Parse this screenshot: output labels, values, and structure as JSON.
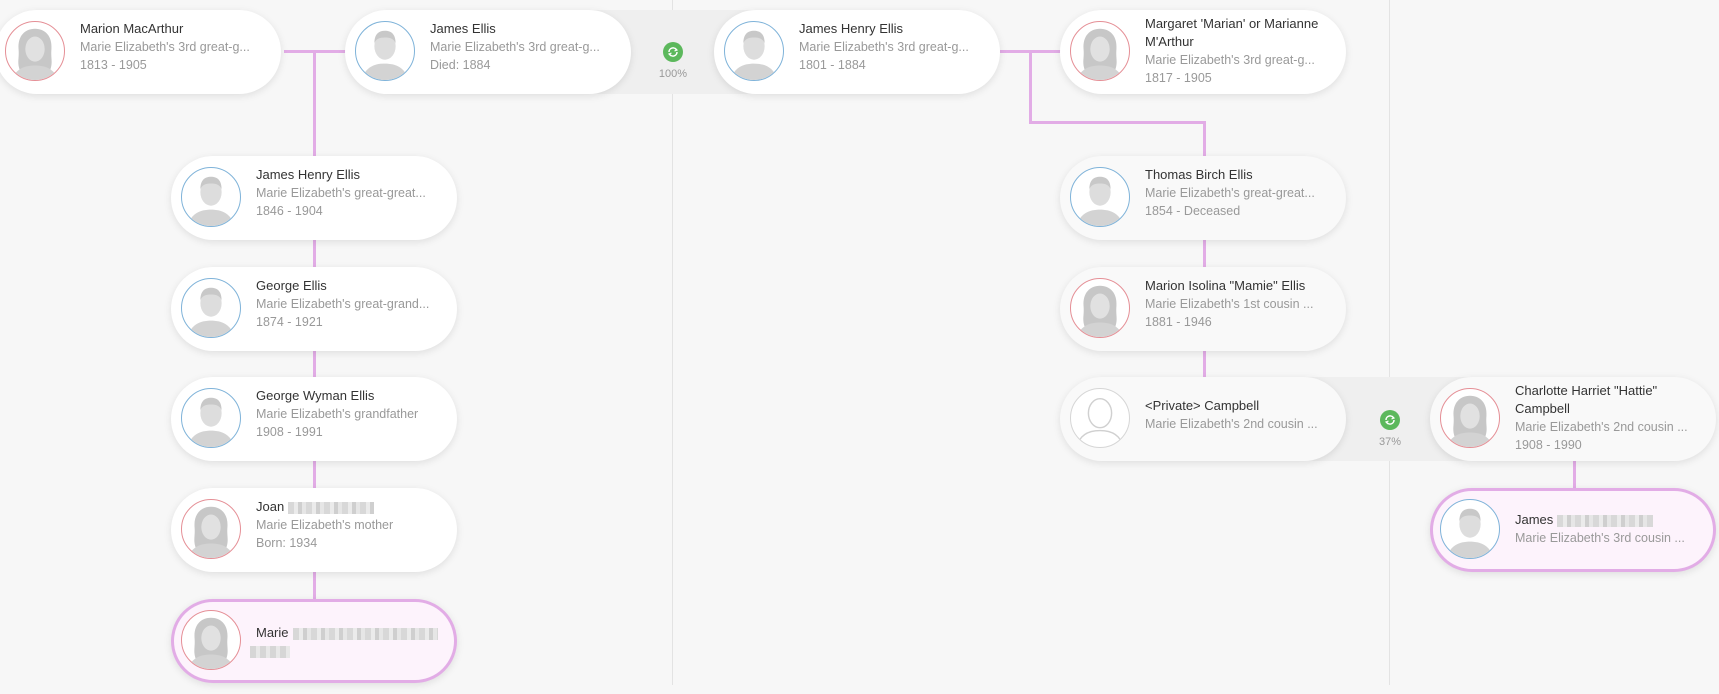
{
  "people": [
    {
      "id": "marion-macarthur",
      "name": "Marion MacArthur",
      "relation": "Marie Elizabeth's 3rd great-g...",
      "dates": "1813 - 1905",
      "gender": "female",
      "icon": "female-avatar-icon"
    },
    {
      "id": "james-ellis",
      "name": "James Ellis",
      "relation": "Marie Elizabeth's 3rd great-g...",
      "dates": "Died: 1884",
      "gender": "male",
      "icon": "male-avatar-icon"
    },
    {
      "id": "james-henry-ellis-1801",
      "name": "James Henry Ellis",
      "relation": "Marie Elizabeth's 3rd great-g...",
      "dates": "1801 - 1884",
      "gender": "male",
      "icon": "male-avatar-icon"
    },
    {
      "id": "margaret-marian",
      "name": "Margaret 'Marian' or Marianne M'Arthur",
      "relation": "Marie Elizabeth's 3rd great-g...",
      "dates": "1817 - 1905",
      "gender": "female",
      "icon": "female-avatar-icon"
    },
    {
      "id": "james-henry-ellis-1846",
      "name": "James Henry Ellis",
      "relation": "Marie Elizabeth's great-great...",
      "dates": "1846 - 1904",
      "gender": "male",
      "icon": "male-avatar-icon"
    },
    {
      "id": "george-ellis",
      "name": "George Ellis",
      "relation": "Marie Elizabeth's great-grand...",
      "dates": "1874 - 1921",
      "gender": "male",
      "icon": "male-avatar-icon"
    },
    {
      "id": "george-wyman-ellis",
      "name": "George Wyman Ellis",
      "relation": "Marie Elizabeth's grandfather",
      "dates": "1908 - 1991",
      "gender": "male",
      "icon": "male-avatar-icon"
    },
    {
      "id": "joan",
      "name": "Joan",
      "relation": "Marie Elizabeth's mother",
      "dates": "Born: 1934",
      "gender": "female",
      "icon": "female-avatar-icon"
    },
    {
      "id": "marie",
      "name": "Marie",
      "relation": "",
      "dates": "",
      "gender": "female",
      "icon": "female-avatar-icon"
    },
    {
      "id": "thomas-birch-ellis",
      "name": "Thomas Birch Ellis",
      "relation": "Marie Elizabeth's great-great...",
      "dates": "1854 - Deceased",
      "gender": "male",
      "icon": "male-avatar-icon"
    },
    {
      "id": "marion-isolina",
      "name": "Marion Isolina \"Mamie\" Ellis",
      "relation": "Marie Elizabeth's 1st cousin ...",
      "dates": "1881 - 1946",
      "gender": "female",
      "icon": "female-avatar-icon"
    },
    {
      "id": "private-campbell",
      "name": "<Private> Campbell",
      "relation": "Marie Elizabeth's 2nd cousin ...",
      "dates": "",
      "gender": "unknown",
      "icon": "unknown-avatar-icon"
    },
    {
      "id": "charlotte-campbell",
      "name": "Charlotte Harriet \"Hattie\" Campbell",
      "relation": "Marie Elizabeth's 2nd cousin ...",
      "dates": "1908 - 1990",
      "gender": "female",
      "icon": "female-avatar-icon"
    },
    {
      "id": "james-focus",
      "name": "James",
      "relation": "Marie Elizabeth's 3rd cousin ...",
      "dates": "",
      "gender": "male",
      "icon": "male-avatar-icon"
    }
  ],
  "matches": [
    {
      "id": "match-ellis",
      "percent": "100%",
      "icon": "sync-icon"
    },
    {
      "id": "match-campbell",
      "percent": "37%",
      "icon": "sync-icon"
    }
  ],
  "colors": {
    "line": "#e2ace6",
    "male": "#7fb3d9",
    "female": "#e58f96",
    "match": "#5cb85c"
  }
}
